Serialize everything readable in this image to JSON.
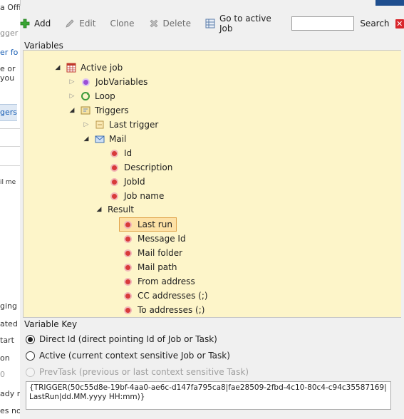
{
  "background_window": {
    "fragments": [
      "a Offi",
      "gger",
      "er fo",
      "e or",
      "you",
      "gers",
      "il me",
      "ging",
      "ated",
      "tart",
      "on",
      "0",
      "ady r",
      "es no"
    ]
  },
  "toolbar": {
    "add_label": "Add",
    "edit_label": "Edit",
    "clone_label": "Clone",
    "delete_label": "Delete",
    "goto_label": "Go to active Job",
    "search_value": "",
    "search_label": "Search"
  },
  "variables": {
    "label": "Variables",
    "tree": {
      "active_job": "Active job",
      "job_variables": "JobVariables",
      "loop": "Loop",
      "triggers": "Triggers",
      "last_trigger": "Last trigger",
      "mail": "Mail",
      "mail_fields": [
        "Id",
        "Description",
        "JobId",
        "Job name"
      ],
      "result": "Result",
      "result_fields": [
        "Last run",
        "Message Id",
        "Mail folder",
        "Mail path",
        "From address",
        "CC addresses (;)",
        "To addresses (;)"
      ],
      "selected": "Last run"
    }
  },
  "variable_key": {
    "label": "Variable Key",
    "options": [
      {
        "label": "Direct Id (direct pointing Id of Job or Task)",
        "checked": true,
        "enabled": true
      },
      {
        "label": "Active (current context sensitive Job or Task)",
        "checked": false,
        "enabled": true
      },
      {
        "label": "PrevTask (previous or last context sensitive Task)",
        "checked": false,
        "enabled": false
      }
    ],
    "text": "{TRIGGER(50c55d8e-19bf-4aa0-ae6c-d147fa795ca8|fae28509-2fbd-4c10-80c4-c94c35587169|LastRun|dd.MM.yyyy HH:mm)}"
  },
  "colors": {
    "tree_background": "#fdf5c9",
    "selection_fill": "#fde1a6",
    "selection_border": "#e0a34b",
    "dot_red": "#d83a3a",
    "close_red": "#d8262b"
  }
}
